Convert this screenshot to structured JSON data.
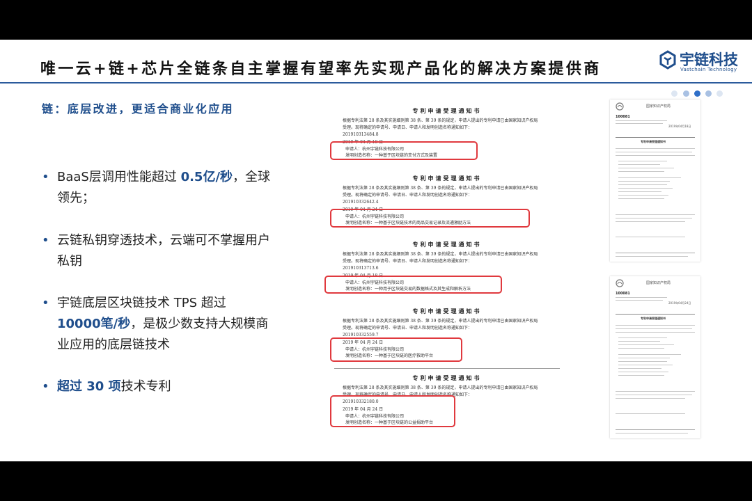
{
  "slide": {
    "title": "唯一云+链+芯片全链条自主掌握有望率先实现产品化的解决方案提供商",
    "logo": {
      "name": "宇链科技",
      "subtitle": "Vastchain Technology",
      "icon": "vastchain-logo-icon",
      "color": "#1f4e8c"
    },
    "subtitle": "链：底层改进，更适合商业化应用",
    "accent_color": "#1f4e8c",
    "highlight_box_color": "#e0393e"
  },
  "bullets": [
    {
      "before": "BaaS层调用性能超过 ",
      "highlight": "0.5亿/秒",
      "after": "，全球领先；"
    },
    {
      "before": "云链私钥穿透技术，云端可不掌握用户私钥",
      "highlight": "",
      "after": ""
    },
    {
      "before": "宇链底层区块链技术 TPS 超过 ",
      "highlight": "10000笔/秒",
      "after": "，是极少数支持大规模商业应用的底层链技术"
    },
    {
      "before": "",
      "highlight": "超过 30 项",
      "after": "技术专利"
    }
  ],
  "pager": {
    "count": 5,
    "active": 2
  },
  "patent_notices": {
    "heading": "专利申请受理通知书",
    "body_1": "根据专利法第 28 条及其实施细则第 38 条、第 39 条的规定，申请人提出的专利申请已由国家知识产权局",
    "body_2": "受理。现将确定的申请号、申请日、申请人和发明创造名称通知如下：",
    "items": [
      {
        "number": "201910313484.8",
        "date": "2019 年 04 月 18 日",
        "applicant": "申请人：杭州宇链科技有限公司",
        "title": "发明创造名称：一种基于区块链的支付方式及装置"
      },
      {
        "number": "201910332642.4",
        "date": "2019 年 04 月 24 日",
        "applicant": "申请人：杭州宇链科技有限公司",
        "title": "发明创造名称：一种基于区块链技术的商品交易记录及流通激励方法"
      },
      {
        "number": "201910313713.6",
        "date": "2019 年 04 月 18 日",
        "applicant": "申请人：杭州宇链科技有限公司",
        "title": "发明创造名称：一种用于区块链交易的数据格式及其生成和解析方法"
      },
      {
        "number": "201910332559.7",
        "date": "2019 年 04 月 24 日",
        "applicant": "申请人：杭州宇链科技有限公司",
        "title": "发明创造名称：一种基于区块链的医疗救助平台"
      },
      {
        "number": "201910332180.0",
        "date": "2019 年 04 月 24 日",
        "applicant": "申请人：杭州宇链科技有限公司",
        "title": "发明创造名称：一种基于区块链的公益捐助平台"
      }
    ]
  },
  "thumbnails": [
    {
      "header": "国家知识产权局",
      "code": "100081",
      "section": "专利申请受理通知书",
      "date": "2019年04月18日"
    },
    {
      "header": "国家知识产权局",
      "code": "100081",
      "section": "专利申请受理通知书",
      "date": "2019年04月24日"
    }
  ]
}
